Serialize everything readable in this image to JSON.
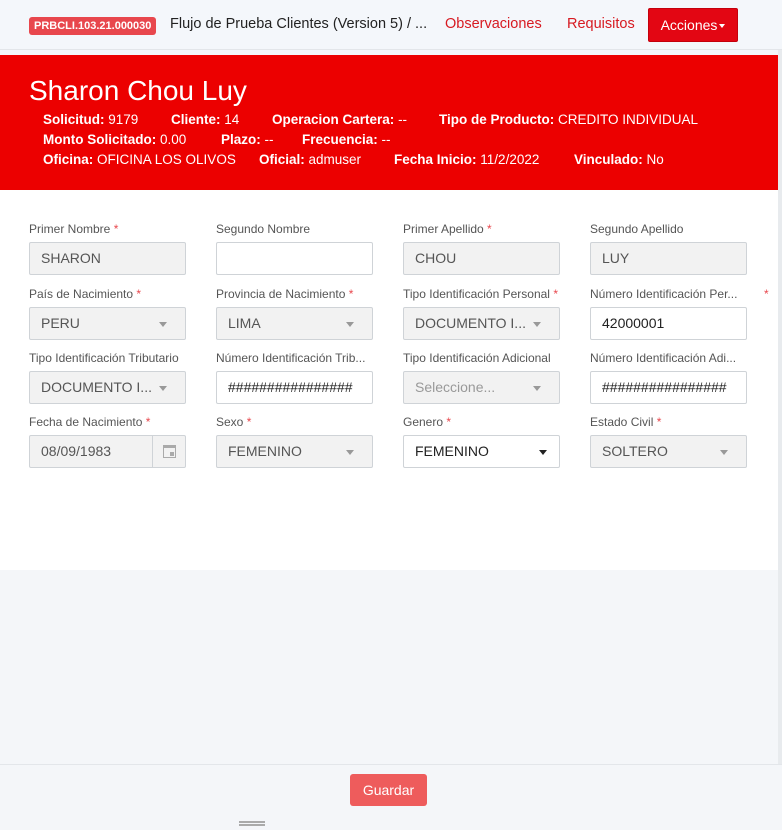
{
  "topbar": {
    "code": "PRBCLI.103.21.000030",
    "flow_title": "Flujo de Prueba Clientes (Version 5) / ...",
    "links": {
      "observaciones": "Observaciones",
      "requisitos": "Requisitos"
    },
    "acciones": "Acciones"
  },
  "header": {
    "name": "Sharon Chou Luy",
    "fields": {
      "solicitud": {
        "label": "Solicitud:",
        "value": "9179"
      },
      "cliente": {
        "label": "Cliente:",
        "value": "14"
      },
      "operacion": {
        "label": "Operacion Cartera:",
        "value": "--"
      },
      "tipo_producto": {
        "label": "Tipo de Producto:",
        "value": "CREDITO INDIVIDUAL"
      },
      "monto": {
        "label": "Monto Solicitado:",
        "value": "0.00"
      },
      "plazo": {
        "label": "Plazo:",
        "value": "--"
      },
      "frecuencia": {
        "label": "Frecuencia:",
        "value": "--"
      },
      "oficina": {
        "label": "Oficina:",
        "value": "OFICINA LOS OLIVOS"
      },
      "oficial": {
        "label": "Oficial:",
        "value": "admuser"
      },
      "fecha_inicio": {
        "label": "Fecha Inicio:",
        "value": "11/2/2022"
      },
      "vinculado": {
        "label": "Vinculado:",
        "value": "No"
      }
    }
  },
  "form": {
    "primer_nombre": {
      "label": "Primer Nombre",
      "value": "SHARON"
    },
    "segundo_nombre": {
      "label": "Segundo Nombre",
      "value": ""
    },
    "primer_apellido": {
      "label": "Primer Apellido",
      "value": "CHOU"
    },
    "segundo_apellido": {
      "label": "Segundo Apellido",
      "value": "LUY"
    },
    "pais_nacimiento": {
      "label": "País de Nacimiento",
      "value": "PERU"
    },
    "provincia_nacimiento": {
      "label": "Provincia de Nacimiento",
      "value": "LIMA"
    },
    "tipo_id_personal": {
      "label": "Tipo Identificación Personal",
      "value": "DOCUMENTO I..."
    },
    "numero_id_personal": {
      "label": "Número Identificación Per...",
      "value": "42000001"
    },
    "tipo_id_tributario": {
      "label": "Tipo Identificación Tributario",
      "value": "DOCUMENTO I..."
    },
    "numero_id_tributario": {
      "label": "Número Identificación Trib...",
      "value": "################"
    },
    "tipo_id_adicional": {
      "label": "Tipo Identificación Adicional",
      "placeholder": "Seleccione..."
    },
    "numero_id_adicional": {
      "label": "Número Identificación Adi...",
      "value": "################"
    },
    "fecha_nacimiento": {
      "label": "Fecha de Nacimiento",
      "value": "08/09/1983"
    },
    "sexo": {
      "label": "Sexo",
      "value": "FEMENINO"
    },
    "genero": {
      "label": "Genero",
      "value": "FEMENINO"
    },
    "estado_civil": {
      "label": "Estado Civil",
      "value": "SOLTERO"
    },
    "required_mark": "*"
  },
  "footer": {
    "guardar": "Guardar"
  },
  "colors": {
    "brand_red": "#ec0000",
    "badge_red": "#e8474d",
    "save_button": "#ee5c5c"
  },
  "icons": {
    "calendar": "calendar-icon",
    "dropdown": "chevron-down-icon",
    "drag": "drag-handle-icon"
  }
}
